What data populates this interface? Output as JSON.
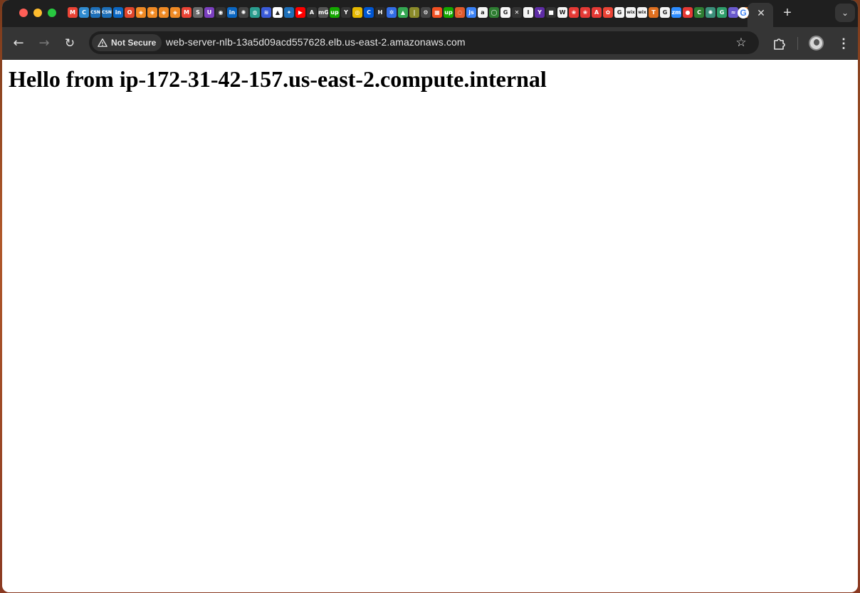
{
  "tabs": {
    "pinned_icons": [
      {
        "icon": "gmail-icon",
        "glyph": "M",
        "color": "#ea4335"
      },
      {
        "icon": "google-circle-icon",
        "glyph": "C",
        "color": "#2f8bd0"
      },
      {
        "icon": "csn-icon",
        "glyph": "CSN",
        "color": "#1d6fb8"
      },
      {
        "icon": "csn-icon-2",
        "glyph": "CSN",
        "color": "#1d6fb8"
      },
      {
        "icon": "linkedin-icon",
        "glyph": "in",
        "color": "#0a66c2"
      },
      {
        "icon": "opera-icon",
        "glyph": "O",
        "color": "#e0452b"
      },
      {
        "icon": "orange-app-icon",
        "glyph": "◈",
        "color": "#f08a24"
      },
      {
        "icon": "orange-app-icon-2",
        "glyph": "◈",
        "color": "#f08a24"
      },
      {
        "icon": "orange-app-icon-3",
        "glyph": "◈",
        "color": "#f08a24"
      },
      {
        "icon": "orange-app-icon-4",
        "glyph": "◈",
        "color": "#f08a24"
      },
      {
        "icon": "gmail-icon-2",
        "glyph": "M",
        "color": "#ea4335"
      },
      {
        "icon": "s-icon",
        "glyph": "S",
        "color": "#6a6a6a"
      },
      {
        "icon": "purple-app-icon",
        "glyph": "U",
        "color": "#7b3fbf"
      },
      {
        "icon": "github-icon",
        "glyph": "◉",
        "color": "#333333"
      },
      {
        "icon": "linkedin-icon-2",
        "glyph": "in",
        "color": "#0a66c2"
      },
      {
        "icon": "openai-icon",
        "glyph": "✺",
        "color": "#444444"
      },
      {
        "icon": "location-icon",
        "glyph": "◍",
        "color": "#2a9d8f"
      },
      {
        "icon": "blue-app-icon",
        "glyph": "≋",
        "color": "#3a5bd9"
      },
      {
        "icon": "graduation-icon",
        "glyph": "▲",
        "color": "#ffffff"
      },
      {
        "icon": "bird-icon",
        "glyph": "✦",
        "color": "#1d6fb8"
      },
      {
        "icon": "youtube-icon",
        "glyph": "▶",
        "color": "#ff0000"
      },
      {
        "icon": "a-icon",
        "glyph": "A",
        "color": "#333333"
      },
      {
        "icon": "mg-icon",
        "glyph": "mG",
        "color": "#555555"
      },
      {
        "icon": "upwork-icon",
        "glyph": "up",
        "color": "#14a800"
      },
      {
        "icon": "y-icon",
        "glyph": "Y",
        "color": "#333333"
      },
      {
        "icon": "coursera-icon",
        "glyph": "◎",
        "color": "#e6b800"
      },
      {
        "icon": "c-icon",
        "glyph": "C",
        "color": "#0056d2"
      },
      {
        "icon": "hr-icon",
        "glyph": "H",
        "color": "#2b2b2b"
      },
      {
        "icon": "kubernetes-icon",
        "glyph": "✲",
        "color": "#326ce5"
      },
      {
        "icon": "drive-icon",
        "glyph": "▲",
        "color": "#34a853"
      },
      {
        "icon": "bars-icon",
        "glyph": "|",
        "color": "#8a8a2a"
      },
      {
        "icon": "gear-icon",
        "glyph": "⚙",
        "color": "#444444"
      },
      {
        "icon": "microsoft-icon",
        "glyph": "▦",
        "color": "#f25022"
      },
      {
        "icon": "upwork-icon-2",
        "glyph": "up",
        "color": "#14a800"
      },
      {
        "icon": "swirl-icon",
        "glyph": "◌",
        "color": "#e05a2b"
      },
      {
        "icon": "js-icon",
        "glyph": "js",
        "color": "#3b82f6"
      },
      {
        "icon": "amazon-icon",
        "glyph": "a",
        "color": "#f5f5f5"
      },
      {
        "icon": "ring-icon",
        "glyph": "◯",
        "color": "#2e7d32"
      },
      {
        "icon": "google-icon",
        "glyph": "G",
        "color": "#f5f5f5"
      },
      {
        "icon": "x-icon",
        "glyph": "✕",
        "color": "#333333"
      },
      {
        "icon": "i-icon",
        "glyph": "I",
        "color": "#f5f5f5"
      },
      {
        "icon": "y-icon-2",
        "glyph": "Y",
        "color": "#5e2ca5"
      },
      {
        "icon": "hs-icon",
        "glyph": "■",
        "color": "#333333"
      },
      {
        "icon": "wikipedia-icon",
        "glyph": "W",
        "color": "#f5f5f5"
      },
      {
        "icon": "red-swirl-icon",
        "glyph": "❀",
        "color": "#e53935"
      },
      {
        "icon": "red-swirl-icon-2",
        "glyph": "❀",
        "color": "#e53935"
      },
      {
        "icon": "red-a-icon",
        "glyph": "A",
        "color": "#e53935"
      },
      {
        "icon": "flower-icon",
        "glyph": "✿",
        "color": "#ea4335"
      },
      {
        "icon": "google-icon-2",
        "glyph": "G",
        "color": "#f5f5f5"
      },
      {
        "icon": "wix-icon",
        "glyph": "wix",
        "color": "#f5f5f5"
      },
      {
        "icon": "wix-icon-2",
        "glyph": "wix",
        "color": "#f5f5f5"
      },
      {
        "icon": "t-icon",
        "glyph": "T",
        "color": "#e07020"
      },
      {
        "icon": "google-icon-3",
        "glyph": "G",
        "color": "#f5f5f5"
      },
      {
        "icon": "zoom-icon",
        "glyph": "zm",
        "color": "#2d8cff"
      },
      {
        "icon": "red-dot-icon",
        "glyph": "●",
        "color": "#e53935"
      },
      {
        "icon": "c-green-icon",
        "glyph": "C",
        "color": "#2e7d32"
      },
      {
        "icon": "chatgpt-icon",
        "glyph": "✺",
        "color": "#3a8f7a"
      },
      {
        "icon": "g-green-icon",
        "glyph": "G",
        "color": "#2e9d6a"
      },
      {
        "icon": "waves-icon",
        "glyph": "≈",
        "color": "#6a5acd"
      },
      {
        "icon": "fw-icon",
        "glyph": "FW",
        "color": "#e07020"
      }
    ],
    "active_tab_icon": "G",
    "close_label": "✕",
    "new_tab_label": "+",
    "tab_search_label": "⌄"
  },
  "toolbar": {
    "back_label": "←",
    "forward_label": "→",
    "reload_label": "↻",
    "security_label": "Not Secure",
    "url": "web-server-nlb-13a5d09acd557628.elb.us-east-2.amazonaws.com",
    "bookmark_label": "☆",
    "menu_label": "⋮"
  },
  "page": {
    "heading": "Hello from ip-172-31-42-157.us-east-2.compute.internal"
  }
}
